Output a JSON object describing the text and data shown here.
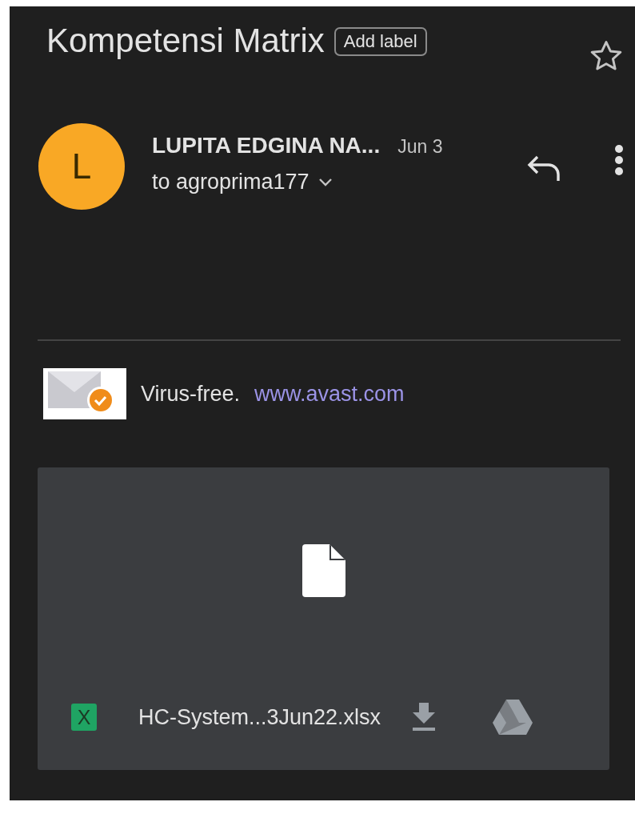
{
  "subject": "Kompetensi Matrix",
  "label_button": "Add label",
  "starred": false,
  "sender": {
    "avatar_letter": "L",
    "name": "LUPITA EDGINA NA...",
    "date": "Jun 3",
    "recipient": "to agroprima177"
  },
  "signature": {
    "text": "Virus-free.",
    "link": "www.avast.com"
  },
  "attachment": {
    "type_letter": "X",
    "filename": "HC-System...3Jun22.xlsx"
  }
}
